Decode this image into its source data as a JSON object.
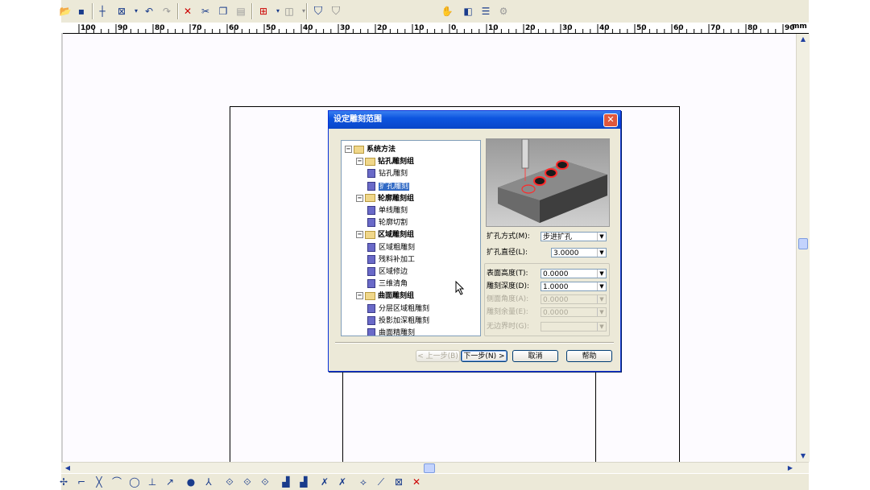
{
  "toolbar": {
    "icons": [
      "open-icon",
      "save-icon",
      "crosshair-icon",
      "select-icon",
      "undo-icon",
      "redo-icon",
      "delete-icon",
      "cut-icon",
      "copy-icon",
      "paste-icon",
      "grid-icon",
      "view-icon",
      "shield-icon",
      "shield-gray-icon",
      "pan-icon",
      "layers-icon",
      "list-icon",
      "settings-icon"
    ]
  },
  "ruler": {
    "labels": [
      "100",
      "90",
      "80",
      "70",
      "60",
      "50",
      "40",
      "30",
      "20",
      "10",
      "0",
      "10",
      "20",
      "30",
      "40",
      "50",
      "60",
      "70",
      "80",
      "90"
    ],
    "unit": "mm"
  },
  "dialog": {
    "title": "设定雕刻范围",
    "close": "✕",
    "tree": [
      {
        "label": "系统方法",
        "level": 0,
        "kind": "folder",
        "bold": true
      },
      {
        "label": "钻孔雕刻组",
        "level": 1,
        "kind": "folder",
        "bold": true
      },
      {
        "label": "钻孔雕刻",
        "level": 2,
        "kind": "leaf"
      },
      {
        "label": "扩孔雕刻",
        "level": 2,
        "kind": "leaf",
        "selected": true
      },
      {
        "label": "轮廓雕刻组",
        "level": 1,
        "kind": "folder",
        "bold": true
      },
      {
        "label": "单线雕刻",
        "level": 2,
        "kind": "leaf"
      },
      {
        "label": "轮廓切割",
        "level": 2,
        "kind": "leaf"
      },
      {
        "label": "区域雕刻组",
        "level": 1,
        "kind": "folder",
        "bold": true
      },
      {
        "label": "区域粗雕刻",
        "level": 2,
        "kind": "leaf"
      },
      {
        "label": "残料补加工",
        "level": 2,
        "kind": "leaf"
      },
      {
        "label": "区域修边",
        "level": 2,
        "kind": "leaf"
      },
      {
        "label": "三维清角",
        "level": 2,
        "kind": "leaf"
      },
      {
        "label": "曲面雕刻组",
        "level": 1,
        "kind": "folder",
        "bold": true
      },
      {
        "label": "分层区域粗雕刻",
        "level": 2,
        "kind": "leaf"
      },
      {
        "label": "投影加深粗雕刻",
        "level": 2,
        "kind": "leaf"
      },
      {
        "label": "曲面精雕刻",
        "level": 2,
        "kind": "leaf"
      }
    ],
    "fields": {
      "ream_method_label": "扩孔方式(M):",
      "ream_method_value": "步进扩孔",
      "ream_diameter_label": "扩孔直径(L):",
      "ream_diameter_value": "3.0000",
      "surface_height_label": "表面高度(T):",
      "surface_height_value": "0.0000",
      "carve_depth_label": "雕刻深度(D):",
      "carve_depth_value": "1.0000",
      "side_angle_label": "侧面角度(A):",
      "side_angle_value": "0.0000",
      "carve_margin_label": "雕刻余量(E):",
      "carve_margin_value": "0.0000",
      "no_boundary_label": "无边界时(G):",
      "no_boundary_value": ""
    },
    "buttons": {
      "prev": "< 上一步(B)",
      "next": "下一步(N) >",
      "cancel": "取消",
      "help": "帮助"
    }
  }
}
